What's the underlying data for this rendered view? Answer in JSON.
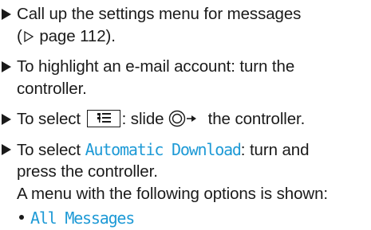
{
  "steps": [
    {
      "line1": "Call up the settings menu for messages",
      "line2_open": "(",
      "line2_pointer_icon": "page-reference-triangle-icon",
      "line2_rest": " page 112)."
    },
    {
      "line1": "To highlight an e-mail account: turn the",
      "line2": "controller."
    },
    {
      "prefix": "To select ",
      "key_icon": "options-menu-key-icon",
      "middle": ": slide ",
      "controller_icon": "controller-slide-right-icon",
      "suffix": " the controller."
    },
    {
      "prefix": "To select ",
      "option": "Automatic Download",
      "suffix": ": turn and",
      "line2": "press the controller.",
      "line3": "A menu with the following options is shown:"
    }
  ],
  "options": [
    "All Messages"
  ],
  "colors": {
    "text": "#1a1a1a",
    "accent": "#1e9ad6"
  }
}
